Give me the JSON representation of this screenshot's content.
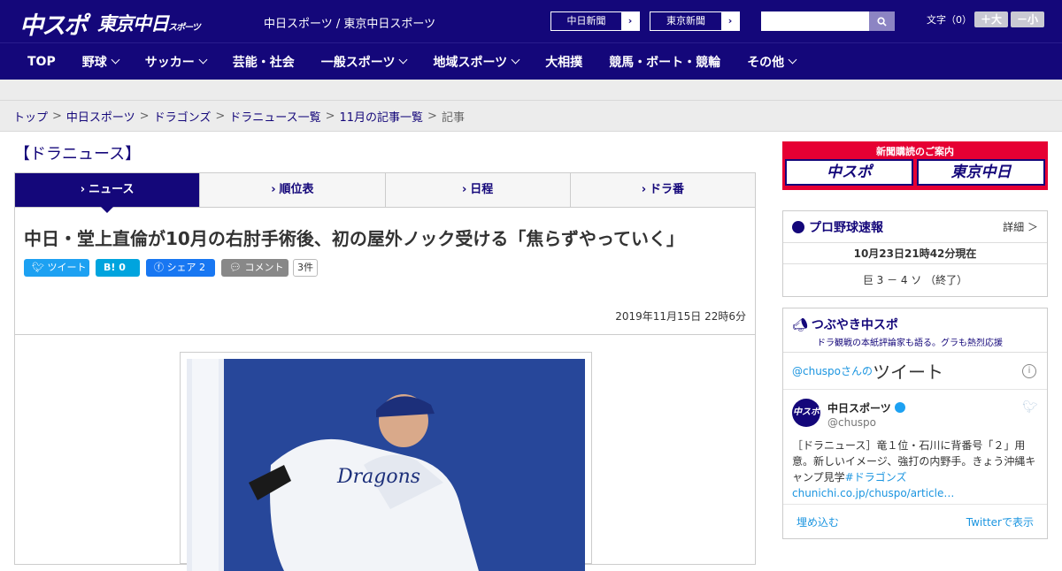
{
  "header": {
    "logo_main": "中スポ",
    "logo_sub": "東京中日",
    "logo_sub_small": "スポーツ",
    "site_title": "中日スポーツ / 東京中日スポーツ",
    "paper_links": [
      "中日新聞",
      "東京新聞"
    ],
    "search_placeholder": "",
    "font_size_label": "文字（0）",
    "font_plus": "＋大",
    "font_minus": "－小"
  },
  "nav": {
    "items": [
      {
        "label": "TOP",
        "dropdown": false
      },
      {
        "label": "野球",
        "dropdown": true
      },
      {
        "label": "サッカー",
        "dropdown": true
      },
      {
        "label": "芸能・社会",
        "dropdown": false
      },
      {
        "label": "一般スポーツ",
        "dropdown": true
      },
      {
        "label": "地域スポーツ",
        "dropdown": true
      },
      {
        "label": "大相撲",
        "dropdown": false
      },
      {
        "label": "競馬・ボート・競輪",
        "dropdown": false
      },
      {
        "label": "その他",
        "dropdown": true
      }
    ]
  },
  "breadcrumb": {
    "items": [
      "トップ",
      "中日スポーツ",
      "ドラゴンズ",
      "ドラニュース一覧",
      "11月の記事一覧"
    ],
    "current": "記事",
    "separator": ">"
  },
  "section": {
    "title": "【ドラニュース】",
    "tabs": [
      "ニュース",
      "順位表",
      "日程",
      "ドラ番"
    ],
    "active_tab": 0
  },
  "article": {
    "headline": "中日・堂上直倫が10月の右肘手術後、初の屋外ノック受ける「焦らずやっていく」",
    "share_tweet": "ツイート",
    "share_hatena": "B! 0",
    "share_facebook": "シェア 2",
    "share_comment": "コメント",
    "comment_count": "3件",
    "date": "2019年11月15日 22時6分"
  },
  "sidebar": {
    "subscribe_title": "新聞購読のご案内",
    "subscribe_buttons": [
      "中スポ",
      "東京中日"
    ],
    "pro_baseball": {
      "title": "プロ野球速報",
      "more": "詳細 ＞",
      "timestamp": "10月23日21時42分現在",
      "score": "巨 3 － 4 ソ （終了）"
    },
    "tweets": {
      "title": "つぶやき中スポ",
      "subtitle": "ドラ観戦の本紙評論家も語る。グラも熱烈応援",
      "handle_prefix": "@chuspoさんの",
      "handle_title": "ツイート",
      "author_name": "中日スポーツ",
      "author_handle": "@chuspo",
      "avatar_text": "中スポ",
      "text": "［ドラニュース］竜１位・石川に背番号「２」用意。新しいイメージ、強打の内野手。きょう沖縄キャンプ見学",
      "hashtag": "#ドラゴンズ",
      "link": "chunichi.co.jp/chuspo/article…",
      "embed": "埋め込む",
      "view_on_twitter": "Twitterで表示"
    }
  },
  "colors": {
    "brand": "#14077a",
    "subscribe_red": "#e60033",
    "twitter_blue": "#1da1f2"
  }
}
